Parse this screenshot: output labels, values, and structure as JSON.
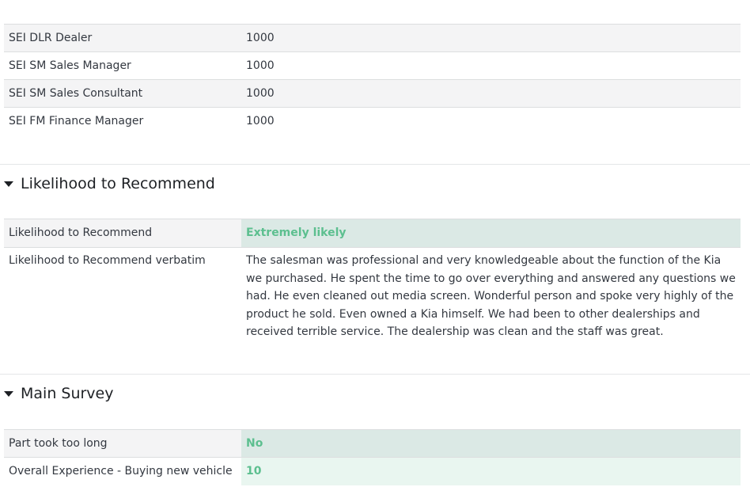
{
  "dealer_rows": [
    {
      "label": "SEI DLR Dealer",
      "value": "1000"
    },
    {
      "label": "SEI SM Sales Manager",
      "value": "1000"
    },
    {
      "label": "SEI SM Sales Consultant",
      "value": "1000"
    },
    {
      "label": "SEI FM Finance Manager",
      "value": "1000"
    }
  ],
  "likelihood_section": {
    "title": "Likelihood to Recommend",
    "rows": [
      {
        "label": "Likelihood to Recommend",
        "value": "Extremely likely"
      },
      {
        "label": "Likelihood to Recommend verbatim",
        "value": "The salesman was professional and very knowledgeable about the function of the Kia we purchased. He spent the time to go over everything and answered any questions we had. He even cleaned out media screen. Wonderful person and spoke very highly of the product he sold. Even owned a Kia himself. We had been to other dealerships and received terrible service. The dealership was clean and the staff was great."
      }
    ]
  },
  "main_survey_section": {
    "title": "Main Survey",
    "rows": [
      {
        "label": "Part took too long",
        "value": "No"
      },
      {
        "label": "Overall Experience - Buying new vehicle",
        "value": "10"
      }
    ]
  },
  "colors": {
    "score_green": "#5cbf8f",
    "highlight_gray": "#dbe9e5",
    "highlight_mint": "#e9f6f0",
    "row_gray": "#f4f4f5"
  },
  "icons": {
    "section_toggle": "caret-down-icon"
  }
}
